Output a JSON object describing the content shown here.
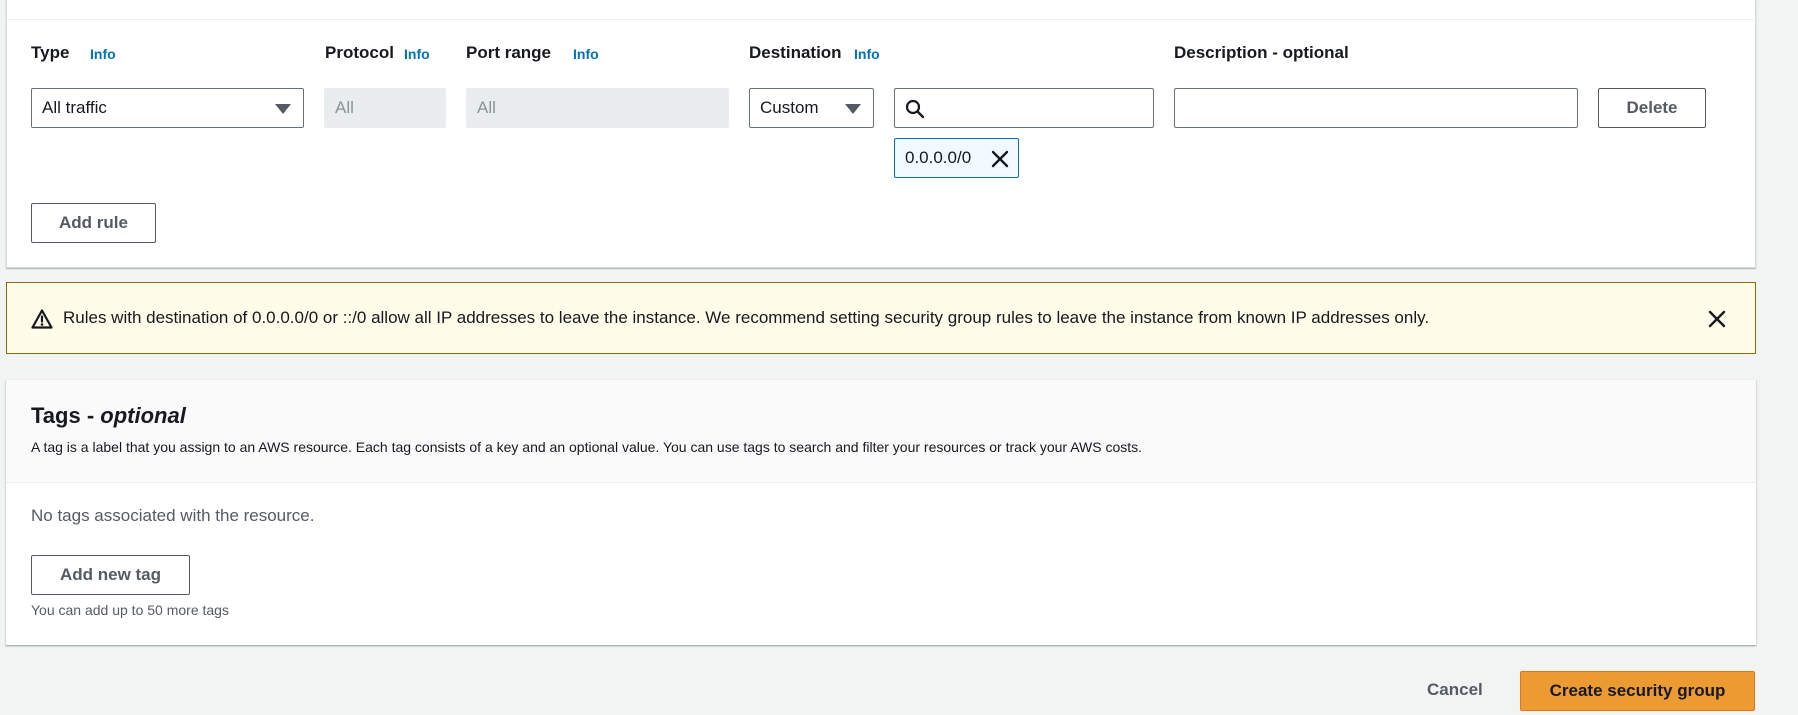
{
  "rules": {
    "headers": {
      "type": "Type",
      "protocol": "Protocol",
      "port_range": "Port range",
      "destination": "Destination",
      "description": "Description - optional"
    },
    "info_label": "Info",
    "row": {
      "type_value": "All traffic",
      "protocol_value": "All",
      "port_range_value": "All",
      "destination_type": "Custom",
      "destination_search_value": "",
      "destination_token": "0.0.0.0/0",
      "description_value": "",
      "delete_label": "Delete"
    },
    "add_rule_label": "Add rule"
  },
  "warning": {
    "text": "Rules with destination of 0.0.0.0/0 or ::/0 allow all IP addresses to leave the instance. We recommend setting security group rules to leave the instance from known IP addresses only."
  },
  "tags": {
    "title_main": "Tags - ",
    "title_optional": "optional",
    "description": "A tag is a label that you assign to an AWS resource. Each tag consists of a key and an optional value. You can use tags to search and filter your resources or track your AWS costs.",
    "empty_text": "No tags associated with the resource.",
    "add_label": "Add new tag",
    "limit_hint": "You can add up to 50 more tags"
  },
  "footer": {
    "cancel_label": "Cancel",
    "create_label": "Create security group"
  },
  "colors": {
    "link": "#0073bb",
    "primary": "#ec9a32",
    "warning_bg": "#fffce9",
    "warning_border": "#906806"
  },
  "icons": {
    "dropdown": "caret-down-icon",
    "search": "search-icon",
    "remove_token": "close-icon",
    "warning": "warning-triangle-icon",
    "dismiss": "close-icon"
  }
}
